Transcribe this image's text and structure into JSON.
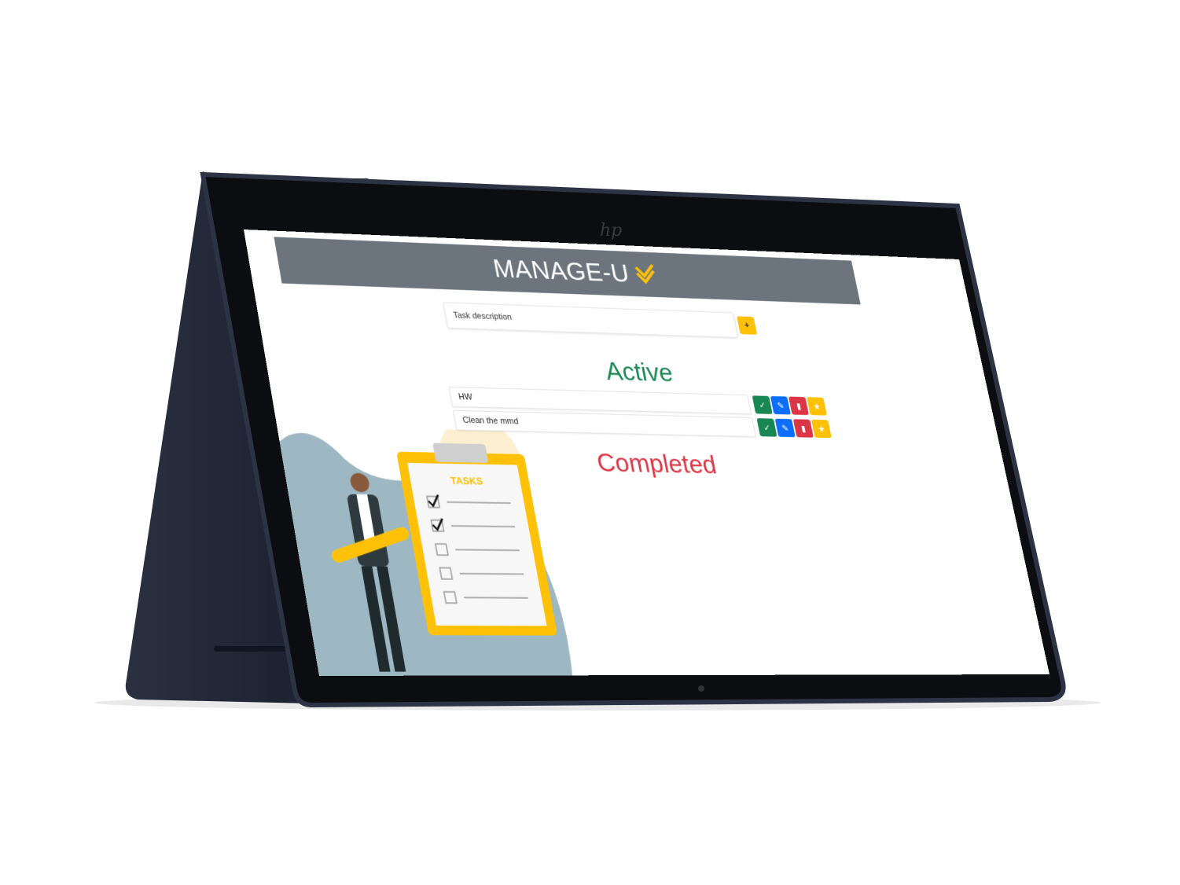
{
  "app": {
    "title": "MANAGE-U",
    "logo_icon": "double-check-icon",
    "brand_color": "#ffc107",
    "header_color": "#6c757d"
  },
  "form": {
    "input_placeholder": "Task description",
    "add_label": "+"
  },
  "sections": {
    "active_title": "Active",
    "active_color": "#198754",
    "completed_title": "Completed",
    "completed_color": "#dc3545"
  },
  "tasks": [
    {
      "text": "HW"
    },
    {
      "text": "Clean the mmd"
    }
  ],
  "task_actions": [
    {
      "icon": "check-icon",
      "color": "#198754"
    },
    {
      "icon": "pencil-icon",
      "color": "#0d6efd"
    },
    {
      "icon": "trash-icon",
      "color": "#dc3545"
    },
    {
      "icon": "star-icon",
      "color": "#ffc107"
    }
  ],
  "illustration": {
    "clipboard_label": "TASKS"
  }
}
